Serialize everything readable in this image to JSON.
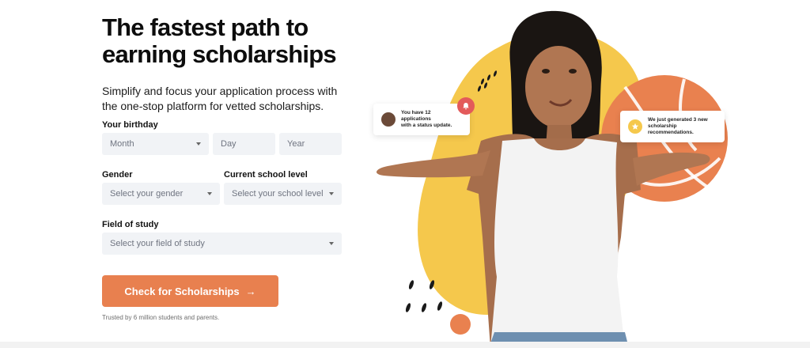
{
  "hero": {
    "headline_line1": "The fastest path to",
    "headline_line2": "earning scholarships",
    "subheading": "Simplify and focus your application process with the one-stop platform for vetted scholarships."
  },
  "form": {
    "birthday_label": "Your birthday",
    "month_placeholder": "Month",
    "day_placeholder": "Day",
    "year_placeholder": "Year",
    "gender_label": "Gender",
    "gender_placeholder": "Select your gender",
    "school_label": "Current school level",
    "school_placeholder": "Select your school level",
    "field_label": "Field of study",
    "field_placeholder": "Select your field of study",
    "cta_label": "Check for Scholarships",
    "cta_arrow": "→",
    "trusted_text": "Trusted by 6 million students and parents."
  },
  "notifications": {
    "applications_line1": "You have 12 applications",
    "applications_line2": "with a status update.",
    "recommendations_line1": "We just generated 3 new",
    "recommendations_line2": "scholarship recommendations."
  },
  "colors": {
    "accent": "#e8804f",
    "yellow_blob": "#f5c84c",
    "orange_blob": "#e9814f",
    "field_bg": "#f1f3f6"
  },
  "icons": {
    "bell": "bell-icon",
    "star": "star-icon",
    "chevron": "chevron-down-icon",
    "arrow": "arrow-right-icon"
  }
}
